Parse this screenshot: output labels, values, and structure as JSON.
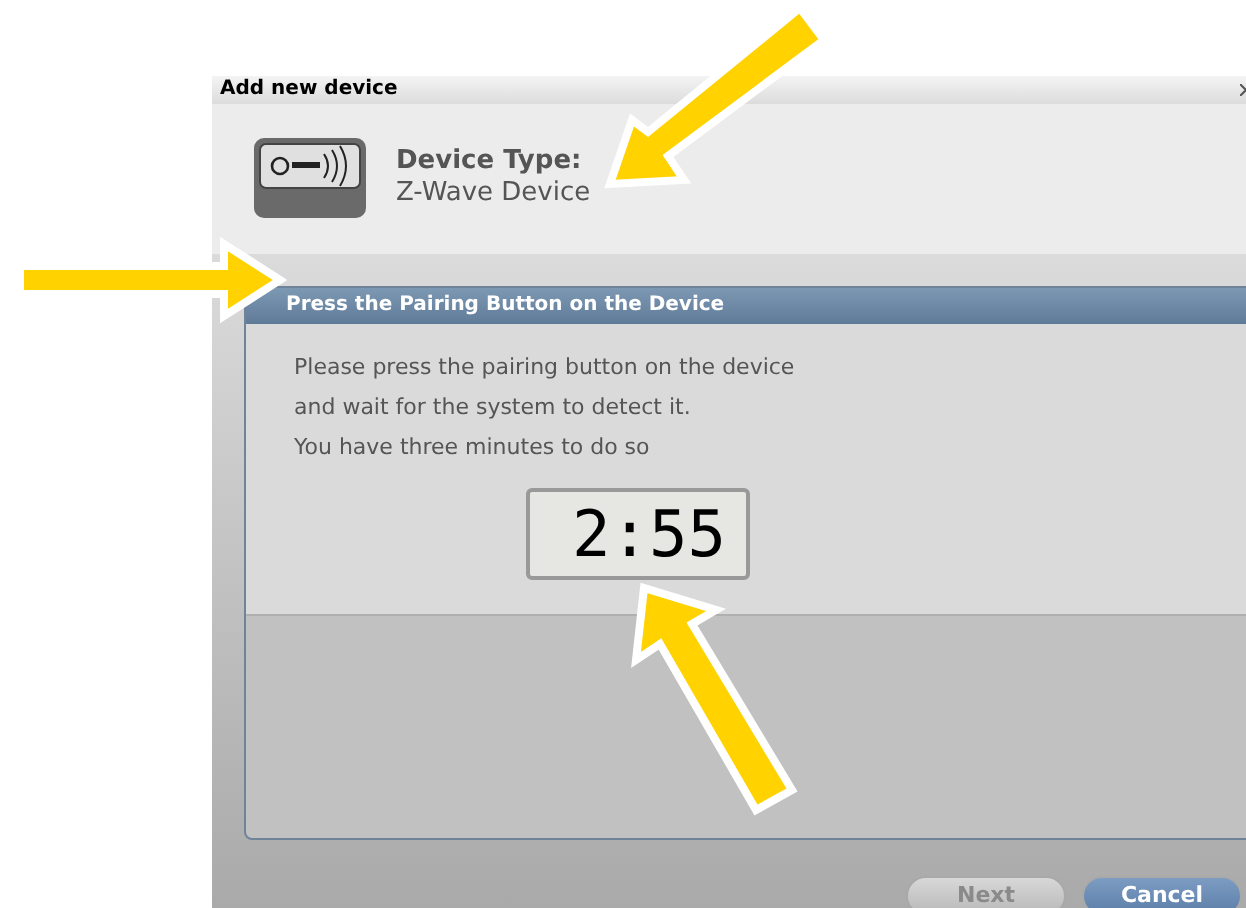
{
  "window": {
    "title": "Add new device"
  },
  "device": {
    "label": "Device Type:",
    "value": "Z-Wave Device"
  },
  "section": {
    "title": "Press the Pairing Button on the Device"
  },
  "instructions": [
    "Please press the pairing button on the device",
    "and wait for the system to detect it.",
    "You have three minutes to do so"
  ],
  "timer": "2:55",
  "buttons": [
    {
      "label": "Next",
      "kind": "secondary",
      "disabled": true
    },
    {
      "label": "Cancel",
      "kind": "primary",
      "disabled": false
    }
  ]
}
